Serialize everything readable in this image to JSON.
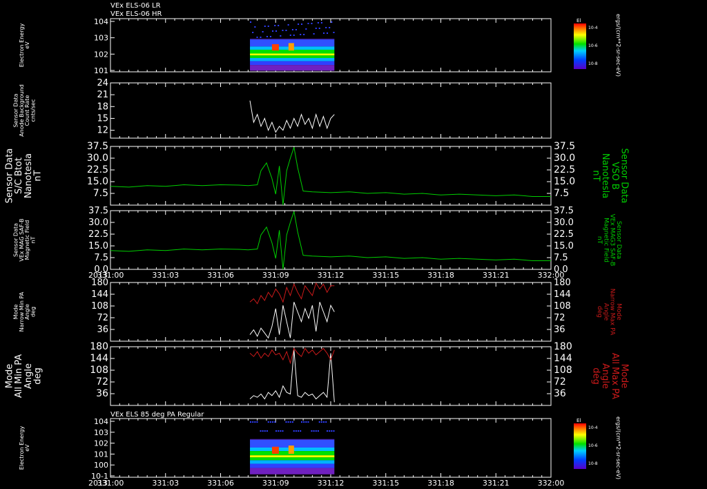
{
  "colors": {
    "background": "#000000",
    "frame": "#ffffff",
    "white_trace": "#ffffff",
    "green_trace": "#00d000",
    "red_trace": "#cc1a1a"
  },
  "titles": {
    "panel1_line1": "VEx ELS-06 LR",
    "panel1_line2": "VEx ELS-06 HR",
    "panel7": "VEx ELS 85 deg PA Regular"
  },
  "time_axis": {
    "year": "2013",
    "ticks": [
      "331:00",
      "331:03",
      "331:06",
      "331:09",
      "331:12",
      "331:15",
      "331:18",
      "331:21",
      "332:00"
    ],
    "range_hours": [
      0,
      24
    ],
    "data_hours": [
      7.6,
      12.2
    ]
  },
  "chart_data": [
    {
      "id": "electron-spectrogram-1",
      "type": "heatmap",
      "ylabel": [
        "Electron Energy",
        "eV"
      ],
      "yticks": [
        "10^4",
        "10^3",
        "10^2",
        "10^1"
      ],
      "colorbar": {
        "label": "El",
        "units": "ergs/(cm**2-sr-sec-eV)",
        "ticks": [
          "10^-4",
          "10^-6",
          "10^-8"
        ]
      }
    },
    {
      "id": "anode-background",
      "type": "line",
      "ylabel": [
        "Sensor Data",
        "Anode Background",
        "Count Rate",
        "cnts/sec"
      ],
      "yticks": [
        "24",
        "21",
        "18",
        "15",
        "12"
      ],
      "ylim": [
        10,
        24
      ],
      "series": [
        {
          "color": "white_trace",
          "x": [
            7.6,
            7.8,
            8.0,
            8.2,
            8.4,
            8.6,
            8.8,
            9.0,
            9.2,
            9.4,
            9.6,
            9.8,
            10.0,
            10.2,
            10.4,
            10.6,
            10.8,
            11.0,
            11.2,
            11.4,
            11.6,
            11.8,
            12.0,
            12.2
          ],
          "values": [
            19.5,
            14,
            16,
            13,
            15,
            12,
            14,
            11.5,
            13,
            12,
            14.5,
            12.5,
            15,
            13,
            16,
            13.5,
            15,
            12.5,
            16,
            13,
            15.5,
            12.5,
            15,
            16
          ]
        }
      ]
    },
    {
      "id": "sc-btot",
      "type": "line",
      "ylabel": [
        "Sensor Data",
        "S/C Btot",
        "Nanotesla",
        "nT"
      ],
      "ylabel_right": [
        "Sensor Data",
        "VSO B",
        "Nanotesla",
        "nT"
      ],
      "yticks": [
        "37.5",
        "30.0",
        "22.5",
        "15.0",
        "7.5"
      ],
      "ylim": [
        0,
        37.5
      ],
      "series": [
        {
          "color": "green_trace",
          "x": [
            0,
            1,
            2,
            3,
            4,
            5,
            6,
            7,
            7.5,
            8,
            8.2,
            8.5,
            8.8,
            9.0,
            9.2,
            9.4,
            9.6,
            9.8,
            10.0,
            10.2,
            10.5,
            11,
            12,
            13,
            14,
            15,
            16,
            17,
            18,
            19,
            20,
            21,
            22,
            23,
            24
          ],
          "values": [
            12,
            11.5,
            12.5,
            12,
            13,
            12.5,
            13,
            12.8,
            12.5,
            13,
            22,
            27,
            17,
            7,
            25,
            0,
            22,
            30,
            37,
            24,
            9,
            8.5,
            8,
            8.5,
            7.5,
            8,
            7,
            7.5,
            6.5,
            7,
            6.5,
            6,
            6.5,
            5.5,
            5.5
          ]
        }
      ]
    },
    {
      "id": "mag-field",
      "type": "line",
      "ylabel": [
        "Sensor Data",
        "VEx MAG SAF-B",
        "Magnetic Field",
        "nT"
      ],
      "ylabel_right": [
        "Sensor Data",
        "VEx MAG3 SAF-B",
        "Magnetic Field",
        "nT"
      ],
      "yticks": [
        "37.5",
        "30.0",
        "22.5",
        "15.0",
        "7.5",
        "0.0"
      ],
      "ylim": [
        0,
        37.5
      ],
      "series": [
        {
          "color": "green_trace",
          "x": [
            0,
            1,
            2,
            3,
            4,
            5,
            6,
            7,
            7.5,
            8,
            8.2,
            8.5,
            8.8,
            9.0,
            9.2,
            9.4,
            9.6,
            9.8,
            10.0,
            10.2,
            10.5,
            11,
            12,
            13,
            14,
            15,
            16,
            17,
            18,
            19,
            20,
            21,
            22,
            23,
            24
          ],
          "values": [
            12,
            11.5,
            12.5,
            12,
            13,
            12.5,
            13,
            12.8,
            12.5,
            13,
            22,
            27,
            17,
            7,
            25,
            0,
            22,
            30,
            37,
            24,
            9,
            8.5,
            8,
            8.5,
            7.5,
            8,
            7,
            7.5,
            6.5,
            7,
            6.5,
            6,
            6.5,
            5.5,
            5.5
          ]
        }
      ]
    },
    {
      "id": "narrow-pa",
      "type": "line",
      "ylabel": [
        "Mode",
        "Narrow Min PA",
        "Angle",
        "deg"
      ],
      "ylabel_right": [
        "Mode",
        "Narrow Max PA",
        "Angle",
        "deg"
      ],
      "yticks": [
        "180",
        "144",
        "108",
        "72",
        "36"
      ],
      "ylim": [
        0,
        180
      ],
      "series": [
        {
          "name": "Narrow Min PA",
          "color": "white_trace",
          "x": [
            7.6,
            7.8,
            8.0,
            8.2,
            8.4,
            8.6,
            8.8,
            9.0,
            9.2,
            9.4,
            9.6,
            9.8,
            10.0,
            10.2,
            10.4,
            10.6,
            10.8,
            11.0,
            11.2,
            11.4,
            11.6,
            11.8,
            12.0,
            12.2
          ],
          "values": [
            20,
            35,
            15,
            40,
            25,
            10,
            45,
            100,
            20,
            110,
            60,
            10,
            120,
            90,
            60,
            100,
            70,
            110,
            30,
            120,
            90,
            60,
            110,
            90
          ]
        },
        {
          "name": "Narrow Max PA",
          "color": "red_trace",
          "x": [
            7.6,
            7.8,
            8.0,
            8.2,
            8.4,
            8.6,
            8.8,
            9.0,
            9.2,
            9.4,
            9.6,
            9.8,
            10.0,
            10.2,
            10.4,
            10.6,
            10.8,
            11.0,
            11.2,
            11.4,
            11.6,
            11.8,
            12.0,
            12.2
          ],
          "values": [
            120,
            130,
            115,
            140,
            125,
            150,
            135,
            160,
            145,
            120,
            165,
            140,
            175,
            150,
            130,
            170,
            155,
            140,
            178,
            160,
            175,
            150,
            170,
            170
          ]
        }
      ]
    },
    {
      "id": "all-pa",
      "type": "line",
      "ylabel": [
        "Mode",
        "All Min PA",
        "Angle",
        "deg"
      ],
      "ylabel_right": [
        "Mode",
        "All Max PA",
        "Angle",
        "deg"
      ],
      "yticks": [
        "180",
        "144",
        "108",
        "72",
        "36"
      ],
      "ylim": [
        0,
        180
      ],
      "series": [
        {
          "name": "All Min PA",
          "color": "white_trace",
          "x": [
            7.6,
            7.8,
            8.0,
            8.2,
            8.4,
            8.6,
            8.8,
            9.0,
            9.2,
            9.4,
            9.6,
            9.8,
            10.0,
            10.2,
            10.4,
            10.6,
            10.8,
            11.0,
            11.2,
            11.4,
            11.6,
            11.8,
            12.0,
            12.2
          ],
          "values": [
            20,
            30,
            25,
            35,
            20,
            40,
            30,
            45,
            25,
            60,
            40,
            35,
            170,
            30,
            25,
            40,
            30,
            35,
            20,
            30,
            40,
            25,
            160,
            10
          ]
        },
        {
          "name": "All Max PA",
          "color": "red_trace",
          "x": [
            7.6,
            7.8,
            8.0,
            8.2,
            8.4,
            8.6,
            8.8,
            9.0,
            9.2,
            9.4,
            9.6,
            9.8,
            10.0,
            10.2,
            10.4,
            10.6,
            10.8,
            11.0,
            11.2,
            11.4,
            11.6,
            11.8,
            12.0,
            12.2
          ],
          "values": [
            160,
            150,
            165,
            145,
            160,
            150,
            170,
            155,
            160,
            140,
            165,
            130,
            175,
            160,
            150,
            175,
            160,
            170,
            155,
            165,
            175,
            160,
            140,
            170
          ]
        }
      ]
    },
    {
      "id": "electron-spectrogram-85",
      "type": "heatmap",
      "ylabel": [
        "Electron Energy",
        "eV"
      ],
      "yticks": [
        "10^4",
        "10^3",
        "10^2",
        "10^1",
        "10^0",
        "10^-1"
      ],
      "colorbar": {
        "label": "El",
        "units": "ergs/(cm**2-sr-sec-eV)",
        "ticks": [
          "10^-4",
          "10^-6",
          "10^-8"
        ]
      }
    }
  ]
}
